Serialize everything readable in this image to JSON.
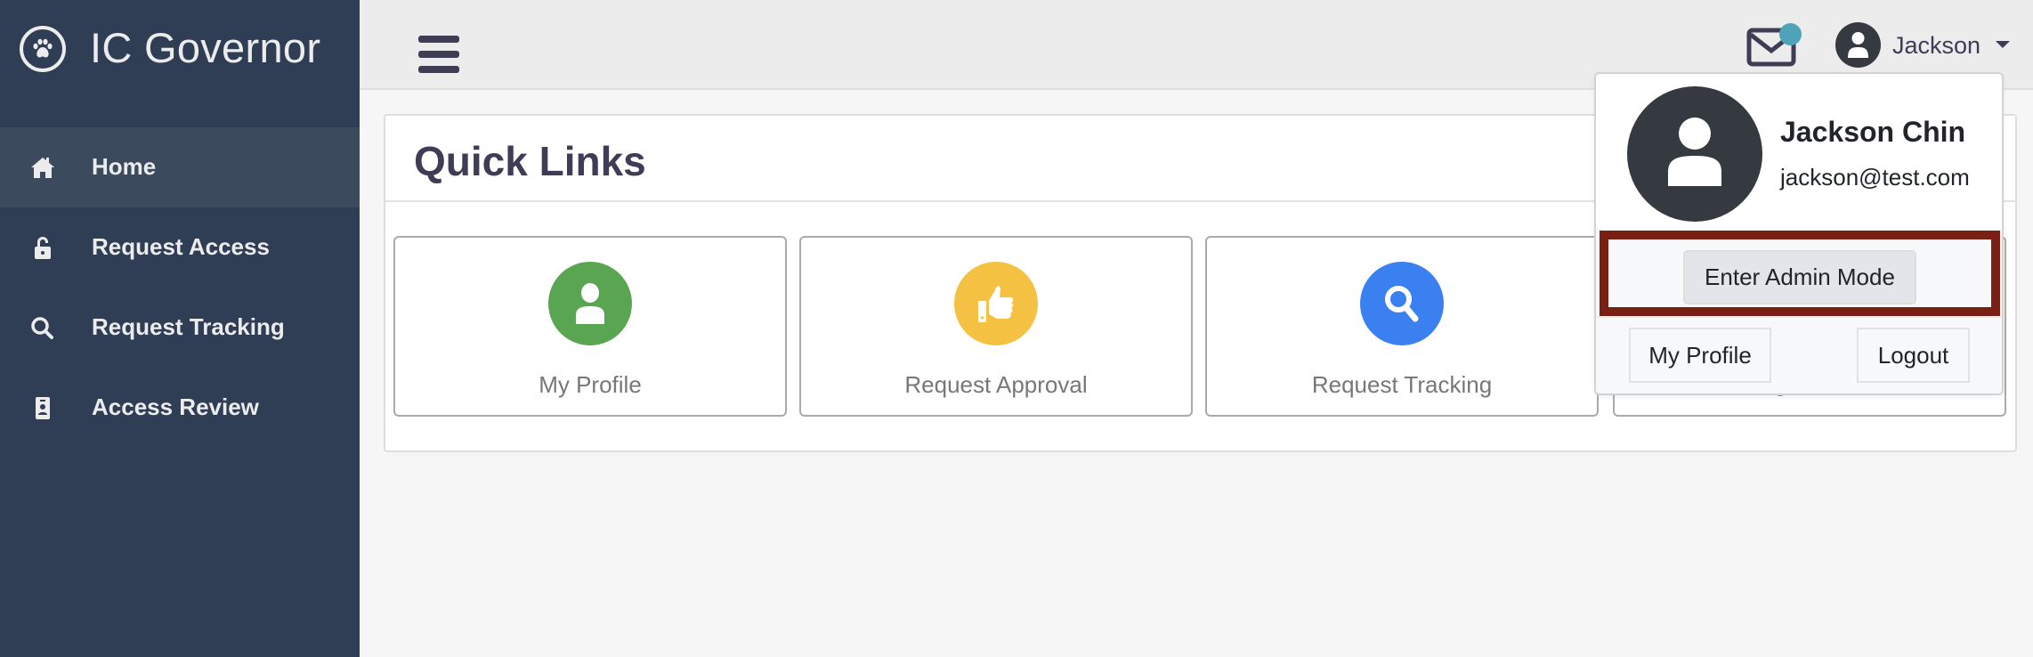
{
  "app": {
    "title": "IC Governor",
    "logo_icon": "paw-icon"
  },
  "sidebar": {
    "items": [
      {
        "label": "Home",
        "icon": "home-icon",
        "active": true
      },
      {
        "label": "Request Access",
        "icon": "unlock-icon",
        "active": false
      },
      {
        "label": "Request Tracking",
        "icon": "search-icon",
        "active": false
      },
      {
        "label": "Access Review",
        "icon": "id-badge-icon",
        "active": false
      }
    ]
  },
  "header": {
    "menu_icon": "hamburger-icon",
    "mail_icon": "envelope-icon",
    "has_notification": true,
    "user_name": "Jackson",
    "colors": {
      "notification_dot": "#4fa3b8"
    }
  },
  "quick_links": {
    "title": "Quick Links",
    "cards": [
      {
        "label": "My Profile",
        "icon": "user-icon",
        "color": "#5aa552"
      },
      {
        "label": "Request Approval",
        "icon": "thumbs-up-icon",
        "color": "#f5c143"
      },
      {
        "label": "Request Tracking",
        "icon": "search-icon",
        "color": "#3a80f0"
      },
      {
        "label": "",
        "icon": "",
        "color": ""
      }
    ]
  },
  "user_dropdown": {
    "full_name": "Jackson Chin",
    "email": "jackson@test.com",
    "admin_button": "Enter Admin Mode",
    "profile_button": "My Profile",
    "logout_button": "Logout",
    "highlight_color": "#7a1f13"
  },
  "colors": {
    "sidebar_bg": "#2f3d55",
    "sidebar_active": "#3c4a5e",
    "header_bg": "#ececec",
    "content_bg": "#f6f6f6",
    "text_primary": "#3f3d56"
  }
}
